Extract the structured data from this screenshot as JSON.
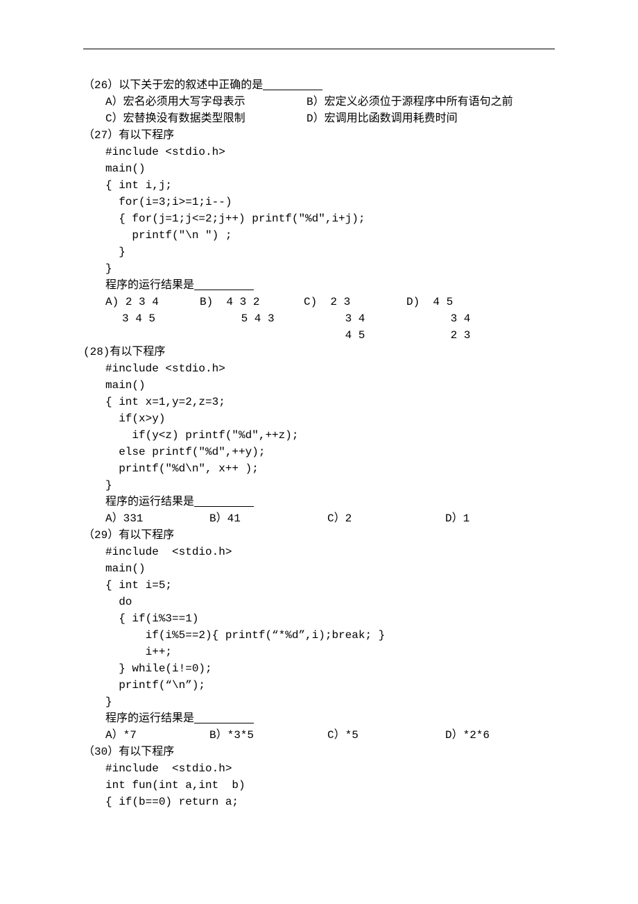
{
  "q26": {
    "number": "（26）",
    "text": "以下关于宏的叙述中正确的是",
    "optA_label": "A）",
    "optA_text": "宏名必须用大写字母表示",
    "optB_label": "B）",
    "optB_text": "宏定义必须位于源程序中所有语句之前",
    "optC_label": "C）",
    "optC_text": "宏替换没有数据类型限制",
    "optD_label": "D）",
    "optD_text": "宏调用比函数调用耗费时间"
  },
  "q27": {
    "number": "（27）",
    "text": "有以下程序",
    "code": [
      "#include <stdio.h>",
      "main()",
      "{ int i,j;",
      "  for(i=3;i>=1;i--)",
      "  { for(j=1;j<=2;j++) printf(\"%d\",i+j);",
      "    printf(\"\\n \") ;",
      "  }",
      "}"
    ],
    "result_label": "程序的运行结果是",
    "opts": {
      "A_label": "A)",
      "B_label": "B)",
      "C_label": "C)",
      "D_label": "D)",
      "row1": {
        "A": "2 3 4",
        "B": " 4 3 2",
        "C": " 2 3",
        "D": " 4 5"
      },
      "row2": {
        "A": "3 4 5",
        "B": " 5 4 3",
        "C": " 3 4",
        "D": " 3 4"
      },
      "row3": {
        "A": "",
        "B": "",
        "C": " 4 5",
        "D": " 2 3"
      }
    }
  },
  "q28": {
    "number": "(28)",
    "text": "有以下程序",
    "code": [
      "#include <stdio.h>",
      "main()",
      "{ int x=1,y=2,z=3;",
      "  if(x>y)",
      "    if(y<z) printf(\"%d\",++z);",
      "  else printf(\"%d\",++y);",
      "  printf(\"%d\\n\", x++ );",
      "}"
    ],
    "result_label": "程序的运行结果是",
    "optA": "A）331",
    "optB": "B）41",
    "optC": "C）2",
    "optD": "D）1"
  },
  "q29": {
    "number": "（29）",
    "text": "有以下程序",
    "code": [
      "#include  <stdio.h>",
      "main()",
      "{ int i=5;",
      "  do",
      "  { if(i%3==1)",
      "      if(i%5==2){ printf(“*%d”,i);break; }",
      "      i++;",
      "  } while(i!=0);",
      "  printf(“\\n”);",
      "}"
    ],
    "result_label": "程序的运行结果是",
    "optA": "A）*7",
    "optB": "B）*3*5",
    "optC": "C）*5",
    "optD": "D）*2*6"
  },
  "q30": {
    "number": "（30）",
    "text": "有以下程序",
    "code": [
      "#include  <stdio.h>",
      "int fun(int a,int  b)",
      "{ if(b==0) return a;"
    ]
  }
}
